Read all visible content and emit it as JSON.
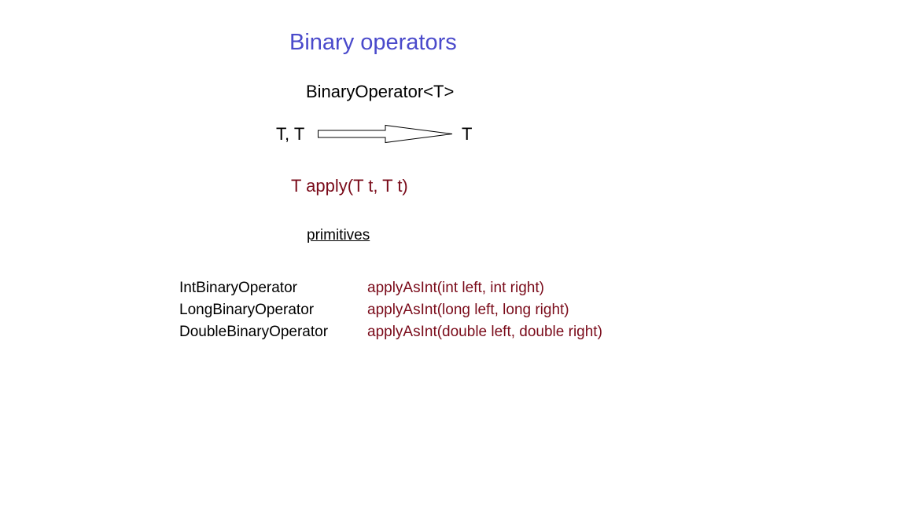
{
  "slide": {
    "title": "Binary operators",
    "interface_name": "BinaryOperator<T>",
    "input_label": "T, T",
    "output_label": "T",
    "method_signature": "T apply(T t, T t)",
    "primitives_heading": "primitives",
    "primitives": [
      {
        "name": "IntBinaryOperator",
        "method": "applyAsInt(int left, int right)"
      },
      {
        "name": "LongBinaryOperator",
        "method": "applyAsInt(long left, long right)"
      },
      {
        "name": "DoubleBinaryOperator",
        "method": "applyAsInt(double left, double right)"
      }
    ]
  },
  "colors": {
    "title": "#4a4acb",
    "method": "#7a0b1a",
    "text": "#000000",
    "background": "#ffffff"
  },
  "icons": {
    "arrow": "right-arrow-icon"
  }
}
